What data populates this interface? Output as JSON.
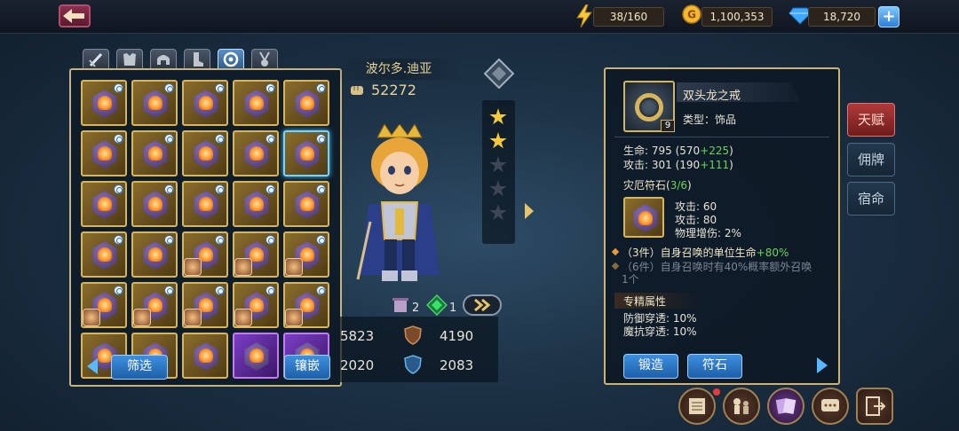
{
  "resources": {
    "energy": "38/160",
    "gold": "1,100,353",
    "diamonds": "18,720"
  },
  "hero": {
    "name": "波尔多.迪亚",
    "power": "52272",
    "stars_filled": 2,
    "stars_total": 6,
    "rune_count": "2",
    "gem_count": "1"
  },
  "stats": {
    "left_top": "5823",
    "right_top": "4190",
    "left_bottom": "2020",
    "right_bottom": "2083"
  },
  "rune_panel": {
    "filter_label": "筛选",
    "inlay_label": "镶嵌",
    "tabs": [
      "weapon",
      "armor",
      "helmet",
      "boots",
      "accessory",
      "amulet"
    ],
    "active_tab": 4
  },
  "item": {
    "name": "双头龙之戒",
    "level": "9",
    "type_label": "类型：饰品",
    "hp_label": "生命:",
    "hp_value": "795 (570",
    "hp_bonus": "+225",
    "hp_close": ")",
    "atk_label": "攻击:",
    "atk_value": "301 (190",
    "atk_bonus": "+111",
    "atk_close": ")",
    "rune_set_title": "灾厄符石(",
    "rune_set_count": "3/6",
    "rune_set_close": ")",
    "rune_stats": [
      {
        "label": "攻击:",
        "value": "60"
      },
      {
        "label": "攻击:",
        "value": "80"
      },
      {
        "label": "物理增伤:",
        "value": "2%"
      }
    ],
    "set_bonus_3": "（3件）自身召唤的单位生命",
    "set_bonus_3_value": "+80%",
    "set_bonus_6": "（6件）自身召唤时有40%概率额外召唤",
    "set_bonus_6_cont": "1个",
    "mastery_title": "专精属性",
    "defense_pen": "防御穿透:",
    "defense_pen_value": "10%",
    "magic_pen": "魔抗穿透:",
    "magic_pen_value": "10%",
    "forge_label": "锻造",
    "rune_label": "符石"
  },
  "side_tabs": [
    "天赋",
    "佣牌",
    "宿命"
  ],
  "colors": {
    "gold_border": "#c9b27c",
    "bonus_green": "#6bd35a",
    "button_blue": "#2c7fd6",
    "active_tab_red": "#b03a3a"
  }
}
